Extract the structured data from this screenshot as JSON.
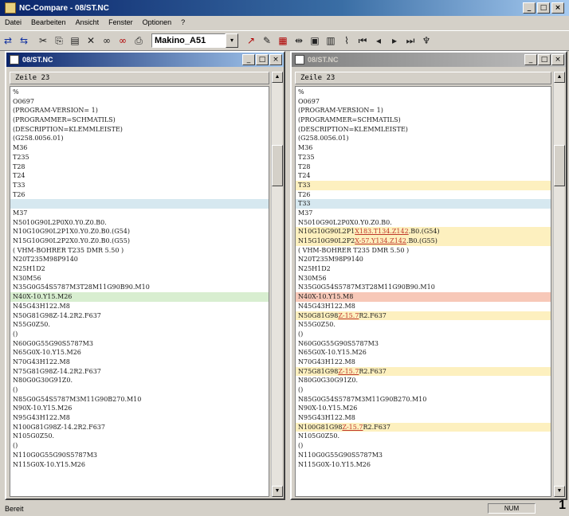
{
  "app": {
    "title": "NC-Compare - 08/ST.NC",
    "window_controls": [
      "_",
      "□",
      "×"
    ]
  },
  "menu": [
    "Datei",
    "Bearbeiten",
    "Ansicht",
    "Fenster",
    "Optionen",
    "?"
  ],
  "toolbar": {
    "machine": "Makino_A51",
    "dropdown_arrow": "▾",
    "left_icons": [
      "compare-icon",
      "compare2-icon",
      "cut-icon",
      "copy-icon",
      "paste-icon",
      "delete-icon",
      "binoculars-icon",
      "binoculars-next-icon",
      "print-icon"
    ],
    "right_icons": [
      "pen-icon",
      "pen2-icon",
      "grid-icon",
      "arrow-split-icon",
      "table-icon",
      "table2-icon",
      "graph-icon",
      "first-icon",
      "prev-icon",
      "next-icon",
      "last-icon",
      "pin-icon"
    ]
  },
  "left_pane": {
    "title": "08/ST.NC",
    "header": "Zeile 23",
    "lines": [
      {
        "t": "%"
      },
      {
        "t": "O0697"
      },
      {
        "t": "(PROGRAM-VERSION= 1)"
      },
      {
        "t": "(PROGRAMMER=SCHMATILS)"
      },
      {
        "t": "(DESCRIPTION=KLEMMLEISTE)"
      },
      {
        "t": "(G258.0056.01)"
      },
      {
        "t": "M36"
      },
      {
        "t": "T235"
      },
      {
        "t": "T28"
      },
      {
        "t": "T24"
      },
      {
        "t": "T33"
      },
      {
        "t": "T26"
      },
      {
        "t": "",
        "hl": "blue"
      },
      {
        "t": "M37"
      },
      {
        "t": "N5010G90L2P0X0.Y0.Z0.B0."
      },
      {
        "t": "N10G10G90L2P1X0.Y0.Z0.B0.(G54)"
      },
      {
        "t": "N15G10G90L2P2X0.Y0.Z0.B0.(G55)"
      },
      {
        "t": "( VHM-BOHRER T235 DMR 5.50 )"
      },
      {
        "t": "N20T235M98P9140"
      },
      {
        "t": "N25H1D2"
      },
      {
        "t": "N30M56"
      },
      {
        "t": "N35G0G54S5787M3T28M11G90B90.M10"
      },
      {
        "t": "N40X-10.Y15.M26",
        "hl": "green"
      },
      {
        "t": "N45G43H122.M8"
      },
      {
        "t": "N50G81G98Z-14.2R2.F637"
      },
      {
        "t": "N55G0Z50."
      },
      {
        "t": "()"
      },
      {
        "t": "N60G0G55G90S5787M3"
      },
      {
        "t": "N65G0X-10.Y15.M26"
      },
      {
        "t": "N70G43H122.M8"
      },
      {
        "t": "N75G81G98Z-14.2R2.F637"
      },
      {
        "t": "N80G0G30G91Z0."
      },
      {
        "t": "()"
      },
      {
        "t": "N85G0G54S5787M3M11G90B270.M10"
      },
      {
        "t": "N90X-10.Y15.M26"
      },
      {
        "t": "N95G43H122.M8"
      },
      {
        "t": "N100G81G98Z-14.2R2.F637"
      },
      {
        "t": "N105G0Z50."
      },
      {
        "t": "()"
      },
      {
        "t": "N110G0G55G90S5787M3"
      },
      {
        "t": "N115G0X-10.Y15.M26"
      }
    ]
  },
  "right_pane": {
    "title": "08/ST.NC",
    "header": "Zeile 23",
    "lines": [
      {
        "t": "%"
      },
      {
        "t": "O0697"
      },
      {
        "t": "(PROGRAM-VERSION= 1)"
      },
      {
        "t": "(PROGRAMMER=SCHMATILS)"
      },
      {
        "t": "(DESCRIPTION=KLEMMLEISTE)"
      },
      {
        "t": "(G258.0056.01)"
      },
      {
        "t": "M36"
      },
      {
        "t": "T235"
      },
      {
        "t": "T28"
      },
      {
        "t": "T24"
      },
      {
        "t": "T33",
        "hl": "yellow"
      },
      {
        "t": "T26"
      },
      {
        "t": "T33",
        "hl": "blue"
      },
      {
        "t": "M37"
      },
      {
        "t": "N5010G90L2P0X0.Y0.Z0.B0."
      },
      {
        "t": "N10G10G90L2P1",
        "d": "X183.T134.Z142",
        "r": ".B0.(G54)",
        "hl": "yellow"
      },
      {
        "t": "N15G10G90L2P2",
        "d": "X-57.Y134.Z142",
        "r": ".B0.(G55)",
        "hl": "yellow"
      },
      {
        "t": "( VHM-BOHRER T235 DMR 5.50 )"
      },
      {
        "t": "N20T235M98P9140"
      },
      {
        "t": "N25H1D2"
      },
      {
        "t": "N30M56"
      },
      {
        "t": "N35G0G54S5787M3T28M11G90B90.M10"
      },
      {
        "t": "N40X-10.Y15.M8",
        "hl": "red"
      },
      {
        "t": "N45G43H122.M8"
      },
      {
        "t": "N50G81G98",
        "d": "Z-15.7",
        "r": "R2.F637",
        "hl": "yellow"
      },
      {
        "t": "N55G0Z50."
      },
      {
        "t": "()"
      },
      {
        "t": "N60G0G55G90S5787M3"
      },
      {
        "t": "N65G0X-10.Y15.M26"
      },
      {
        "t": "N70G43H122.M8"
      },
      {
        "t": "N75G81G98",
        "d": "Z-15.7",
        "r": "R2.F637",
        "hl": "yellow"
      },
      {
        "t": "N80G0G30G91Z0."
      },
      {
        "t": "()"
      },
      {
        "t": "N85G0G54S5787M3M11G90B270.M10"
      },
      {
        "t": "N90X-10.Y15.M26"
      },
      {
        "t": "N95G43H122.M8"
      },
      {
        "t": "N100G81G98",
        "d": "Z-15.7",
        "r": "R2.F637",
        "hl": "yellow"
      },
      {
        "t": "N105G0Z50."
      },
      {
        "t": "()"
      },
      {
        "t": "N110G0G55G90S5787M3"
      },
      {
        "t": "N115G0X-10.Y15.M26"
      }
    ]
  },
  "status": {
    "left": "Bereit",
    "mode": "NUM",
    "page_number": "1"
  }
}
